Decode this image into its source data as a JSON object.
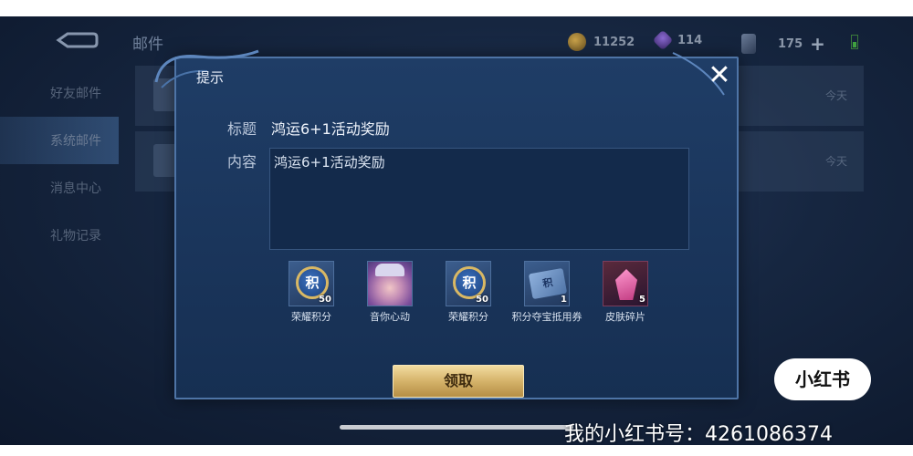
{
  "header": {
    "title": "邮件",
    "resources": [
      {
        "icon": "coin-icon",
        "value": "11252"
      },
      {
        "icon": "gem-icon",
        "value": "114"
      },
      {
        "icon": "ticket-icon",
        "value": "175"
      }
    ]
  },
  "sidebar": {
    "items": [
      {
        "label": "好友邮件",
        "active": false
      },
      {
        "label": "系统邮件",
        "active": true
      },
      {
        "label": "消息中心",
        "active": false
      },
      {
        "label": "礼物记录",
        "active": false
      }
    ]
  },
  "mail_list": [
    {
      "date": "今天"
    },
    {
      "date": "今天"
    }
  ],
  "dialog": {
    "title": "提示",
    "subject_label": "标题",
    "subject_value": "鸿运6+1活动奖励",
    "content_label": "内容",
    "content_value": "鸿运6+1活动奖励",
    "rewards": [
      {
        "name": "荣耀积分",
        "count": "50",
        "icon": "honor-points-icon"
      },
      {
        "name": "音你心动",
        "count": "",
        "icon": "hero-portrait-icon"
      },
      {
        "name": "荣耀积分",
        "count": "50",
        "icon": "honor-points-icon"
      },
      {
        "name": "积分夺宝抵用券",
        "count": "1",
        "icon": "voucher-icon"
      },
      {
        "name": "皮肤碎片",
        "count": "5",
        "icon": "skin-shard-icon"
      }
    ],
    "reward_glyph": "积",
    "claim_label": "领取"
  },
  "overlay": {
    "badge": "小红书",
    "watermark": "我的小红书号：4261086374"
  },
  "colors": {
    "dialog_bg": "#1f3d66",
    "claim_button": "#d5b36a"
  }
}
